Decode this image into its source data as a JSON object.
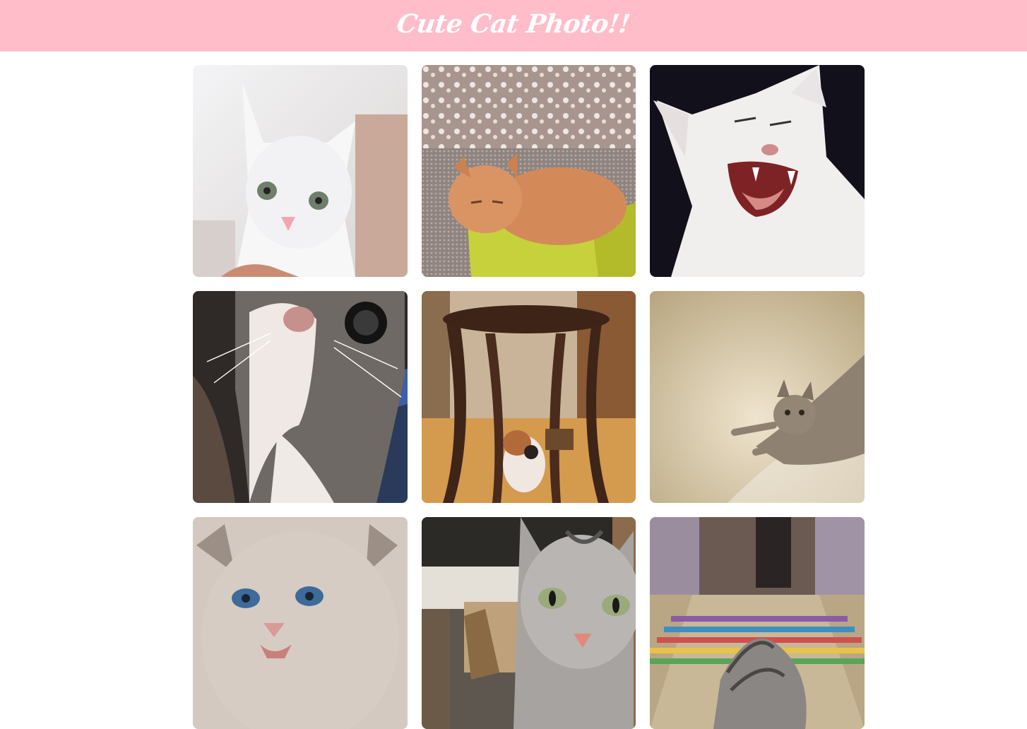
{
  "header": {
    "title": "Cute Cat Photo!!",
    "background": "#ffbdca"
  },
  "photos": [
    {
      "name": "white-kitten-photo"
    },
    {
      "name": "orange-cat-in-box-photo"
    },
    {
      "name": "hissing-white-cat-photo"
    },
    {
      "name": "gray-cat-closeup-photo"
    },
    {
      "name": "calico-under-stool-photo"
    },
    {
      "name": "tabby-on-carpet-photo"
    },
    {
      "name": "blue-eyed-kitten-photo"
    },
    {
      "name": "gray-cat-staring-photo"
    },
    {
      "name": "tabby-on-rug-photo"
    }
  ]
}
